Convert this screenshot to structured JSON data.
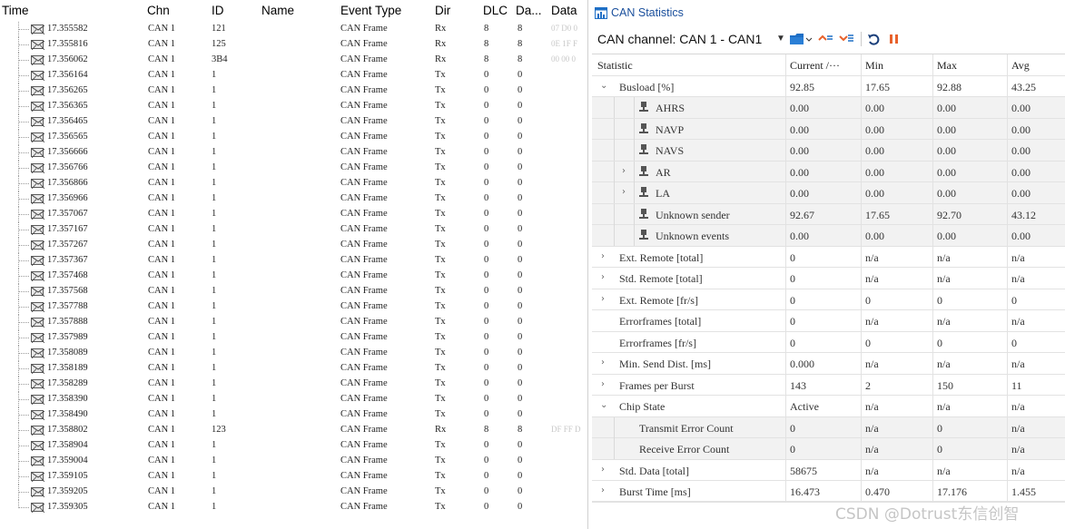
{
  "trace": {
    "columns": {
      "time": "Time",
      "chn": "Chn",
      "id": "ID",
      "name": "Name",
      "event_type": "Event Type",
      "dir": "Dir",
      "dlc": "DLC",
      "da": "Da...",
      "data": "Data"
    },
    "rows": [
      {
        "time": "17.355582",
        "chn": "CAN 1",
        "id": "121",
        "type": "CAN Frame",
        "dir": "Rx",
        "dlc": "8",
        "da": "8",
        "data": "07 D0 0"
      },
      {
        "time": "17.355816",
        "chn": "CAN 1",
        "id": "125",
        "type": "CAN Frame",
        "dir": "Rx",
        "dlc": "8",
        "da": "8",
        "data": "0E 1F F"
      },
      {
        "time": "17.356062",
        "chn": "CAN 1",
        "id": "3B4",
        "type": "CAN Frame",
        "dir": "Rx",
        "dlc": "8",
        "da": "8",
        "data": "00 00 0"
      },
      {
        "time": "17.356164",
        "chn": "CAN 1",
        "id": "1",
        "type": "CAN Frame",
        "dir": "Tx",
        "dlc": "0",
        "da": "0",
        "data": ""
      },
      {
        "time": "17.356265",
        "chn": "CAN 1",
        "id": "1",
        "type": "CAN Frame",
        "dir": "Tx",
        "dlc": "0",
        "da": "0",
        "data": ""
      },
      {
        "time": "17.356365",
        "chn": "CAN 1",
        "id": "1",
        "type": "CAN Frame",
        "dir": "Tx",
        "dlc": "0",
        "da": "0",
        "data": ""
      },
      {
        "time": "17.356465",
        "chn": "CAN 1",
        "id": "1",
        "type": "CAN Frame",
        "dir": "Tx",
        "dlc": "0",
        "da": "0",
        "data": ""
      },
      {
        "time": "17.356565",
        "chn": "CAN 1",
        "id": "1",
        "type": "CAN Frame",
        "dir": "Tx",
        "dlc": "0",
        "da": "0",
        "data": ""
      },
      {
        "time": "17.356666",
        "chn": "CAN 1",
        "id": "1",
        "type": "CAN Frame",
        "dir": "Tx",
        "dlc": "0",
        "da": "0",
        "data": ""
      },
      {
        "time": "17.356766",
        "chn": "CAN 1",
        "id": "1",
        "type": "CAN Frame",
        "dir": "Tx",
        "dlc": "0",
        "da": "0",
        "data": ""
      },
      {
        "time": "17.356866",
        "chn": "CAN 1",
        "id": "1",
        "type": "CAN Frame",
        "dir": "Tx",
        "dlc": "0",
        "da": "0",
        "data": ""
      },
      {
        "time": "17.356966",
        "chn": "CAN 1",
        "id": "1",
        "type": "CAN Frame",
        "dir": "Tx",
        "dlc": "0",
        "da": "0",
        "data": ""
      },
      {
        "time": "17.357067",
        "chn": "CAN 1",
        "id": "1",
        "type": "CAN Frame",
        "dir": "Tx",
        "dlc": "0",
        "da": "0",
        "data": ""
      },
      {
        "time": "17.357167",
        "chn": "CAN 1",
        "id": "1",
        "type": "CAN Frame",
        "dir": "Tx",
        "dlc": "0",
        "da": "0",
        "data": ""
      },
      {
        "time": "17.357267",
        "chn": "CAN 1",
        "id": "1",
        "type": "CAN Frame",
        "dir": "Tx",
        "dlc": "0",
        "da": "0",
        "data": ""
      },
      {
        "time": "17.357367",
        "chn": "CAN 1",
        "id": "1",
        "type": "CAN Frame",
        "dir": "Tx",
        "dlc": "0",
        "da": "0",
        "data": ""
      },
      {
        "time": "17.357468",
        "chn": "CAN 1",
        "id": "1",
        "type": "CAN Frame",
        "dir": "Tx",
        "dlc": "0",
        "da": "0",
        "data": ""
      },
      {
        "time": "17.357568",
        "chn": "CAN 1",
        "id": "1",
        "type": "CAN Frame",
        "dir": "Tx",
        "dlc": "0",
        "da": "0",
        "data": ""
      },
      {
        "time": "17.357788",
        "chn": "CAN 1",
        "id": "1",
        "type": "CAN Frame",
        "dir": "Tx",
        "dlc": "0",
        "da": "0",
        "data": ""
      },
      {
        "time": "17.357888",
        "chn": "CAN 1",
        "id": "1",
        "type": "CAN Frame",
        "dir": "Tx",
        "dlc": "0",
        "da": "0",
        "data": ""
      },
      {
        "time": "17.357989",
        "chn": "CAN 1",
        "id": "1",
        "type": "CAN Frame",
        "dir": "Tx",
        "dlc": "0",
        "da": "0",
        "data": ""
      },
      {
        "time": "17.358089",
        "chn": "CAN 1",
        "id": "1",
        "type": "CAN Frame",
        "dir": "Tx",
        "dlc": "0",
        "da": "0",
        "data": ""
      },
      {
        "time": "17.358189",
        "chn": "CAN 1",
        "id": "1",
        "type": "CAN Frame",
        "dir": "Tx",
        "dlc": "0",
        "da": "0",
        "data": ""
      },
      {
        "time": "17.358289",
        "chn": "CAN 1",
        "id": "1",
        "type": "CAN Frame",
        "dir": "Tx",
        "dlc": "0",
        "da": "0",
        "data": ""
      },
      {
        "time": "17.358390",
        "chn": "CAN 1",
        "id": "1",
        "type": "CAN Frame",
        "dir": "Tx",
        "dlc": "0",
        "da": "0",
        "data": ""
      },
      {
        "time": "17.358490",
        "chn": "CAN 1",
        "id": "1",
        "type": "CAN Frame",
        "dir": "Tx",
        "dlc": "0",
        "da": "0",
        "data": ""
      },
      {
        "time": "17.358802",
        "chn": "CAN 1",
        "id": "123",
        "type": "CAN Frame",
        "dir": "Rx",
        "dlc": "8",
        "da": "8",
        "data": "DF FF D"
      },
      {
        "time": "17.358904",
        "chn": "CAN 1",
        "id": "1",
        "type": "CAN Frame",
        "dir": "Tx",
        "dlc": "0",
        "da": "0",
        "data": ""
      },
      {
        "time": "17.359004",
        "chn": "CAN 1",
        "id": "1",
        "type": "CAN Frame",
        "dir": "Tx",
        "dlc": "0",
        "da": "0",
        "data": ""
      },
      {
        "time": "17.359105",
        "chn": "CAN 1",
        "id": "1",
        "type": "CAN Frame",
        "dir": "Tx",
        "dlc": "0",
        "da": "0",
        "data": ""
      },
      {
        "time": "17.359205",
        "chn": "CAN 1",
        "id": "1",
        "type": "CAN Frame",
        "dir": "Tx",
        "dlc": "0",
        "da": "0",
        "data": ""
      },
      {
        "time": "17.359305",
        "chn": "CAN 1",
        "id": "1",
        "type": "CAN Frame",
        "dir": "Tx",
        "dlc": "0",
        "da": "0",
        "data": ""
      }
    ]
  },
  "stats": {
    "title": "CAN Statistics",
    "channel_label": "CAN channel: CAN 1 - CAN1",
    "dropdown_icon": "dropdown-arrow",
    "toolbar_icons": [
      "folder-icon",
      "expand-all-icon",
      "collapse-all-icon",
      "reset-icon",
      "pause-icon"
    ],
    "columns": {
      "statistic": "Statistic",
      "current": "Current /···",
      "min": "Min",
      "max": "Max",
      "avg": "Avg"
    },
    "rows": [
      {
        "name": "Busload [%]",
        "cur": "92.85",
        "min": "17.65",
        "max": "92.88",
        "avg": "43.25",
        "level": 0,
        "chev": "down",
        "sub": false
      },
      {
        "name": "AHRS",
        "cur": "0.00",
        "min": "0.00",
        "max": "0.00",
        "avg": "0.00",
        "level": 1,
        "chev": "",
        "node": true,
        "sub": true
      },
      {
        "name": "NAVP",
        "cur": "0.00",
        "min": "0.00",
        "max": "0.00",
        "avg": "0.00",
        "level": 1,
        "chev": "",
        "node": true,
        "sub": true
      },
      {
        "name": "NAVS",
        "cur": "0.00",
        "min": "0.00",
        "max": "0.00",
        "avg": "0.00",
        "level": 1,
        "chev": "",
        "node": true,
        "sub": true
      },
      {
        "name": "AR",
        "cur": "0.00",
        "min": "0.00",
        "max": "0.00",
        "avg": "0.00",
        "level": 1,
        "chev": "right",
        "node": true,
        "sub": true
      },
      {
        "name": "LA",
        "cur": "0.00",
        "min": "0.00",
        "max": "0.00",
        "avg": "0.00",
        "level": 1,
        "chev": "right",
        "node": true,
        "sub": true
      },
      {
        "name": "Unknown sender",
        "cur": "92.67",
        "min": "17.65",
        "max": "92.70",
        "avg": "43.12",
        "level": 1,
        "chev": "",
        "node": true,
        "sub": true
      },
      {
        "name": "Unknown events",
        "cur": "0.00",
        "min": "0.00",
        "max": "0.00",
        "avg": "0.00",
        "level": 1,
        "chev": "",
        "node": true,
        "sub": true
      },
      {
        "name": "Ext. Remote [total]",
        "cur": "0",
        "min": "n/a",
        "max": "n/a",
        "avg": "n/a",
        "level": 0,
        "chev": "right",
        "sub": false
      },
      {
        "name": "Std. Remote [total]",
        "cur": "0",
        "min": "n/a",
        "max": "n/a",
        "avg": "n/a",
        "level": 0,
        "chev": "right",
        "sub": false
      },
      {
        "name": "Ext. Remote [fr/s]",
        "cur": "0",
        "min": "0",
        "max": "0",
        "avg": "0",
        "level": 0,
        "chev": "right",
        "sub": false
      },
      {
        "name": "Errorframes [total]",
        "cur": "0",
        "min": "n/a",
        "max": "n/a",
        "avg": "n/a",
        "level": 0,
        "chev": "",
        "sub": false
      },
      {
        "name": "Errorframes [fr/s]",
        "cur": "0",
        "min": "0",
        "max": "0",
        "avg": "0",
        "level": 0,
        "chev": "",
        "sub": false
      },
      {
        "name": "Min. Send Dist. [ms]",
        "cur": "0.000",
        "min": "n/a",
        "max": "n/a",
        "avg": "n/a",
        "level": 0,
        "chev": "right",
        "sub": false
      },
      {
        "name": "Frames per Burst",
        "cur": "143",
        "min": "2",
        "max": "150",
        "avg": "11",
        "level": 0,
        "chev": "right",
        "sub": false
      },
      {
        "name": "Chip State",
        "cur": "Active",
        "min": "n/a",
        "max": "n/a",
        "avg": "n/a",
        "level": 0,
        "chev": "down",
        "sub": false
      },
      {
        "name": "Transmit Error Count",
        "cur": "0",
        "min": "n/a",
        "max": "0",
        "avg": "n/a",
        "level": 2,
        "chev": "",
        "sub": true
      },
      {
        "name": "Receive Error Count",
        "cur": "0",
        "min": "n/a",
        "max": "0",
        "avg": "n/a",
        "level": 2,
        "chev": "",
        "sub": true
      },
      {
        "name": "Std. Data [total]",
        "cur": "58675",
        "min": "n/a",
        "max": "n/a",
        "avg": "n/a",
        "level": 0,
        "chev": "right",
        "sub": false
      },
      {
        "name": "Burst Time [ms]",
        "cur": "16.473",
        "min": "0.470",
        "max": "17.176",
        "avg": "1.455",
        "level": 0,
        "chev": "right",
        "sub": false
      }
    ]
  },
  "watermark": "CSDN @Dotrust东信创智",
  "colors": {
    "title_blue": "#1a4f9c",
    "folder_blue": "#1e6fc6",
    "pause_orange": "#e8622c",
    "sub_row_bg": "#f2f2f2"
  }
}
